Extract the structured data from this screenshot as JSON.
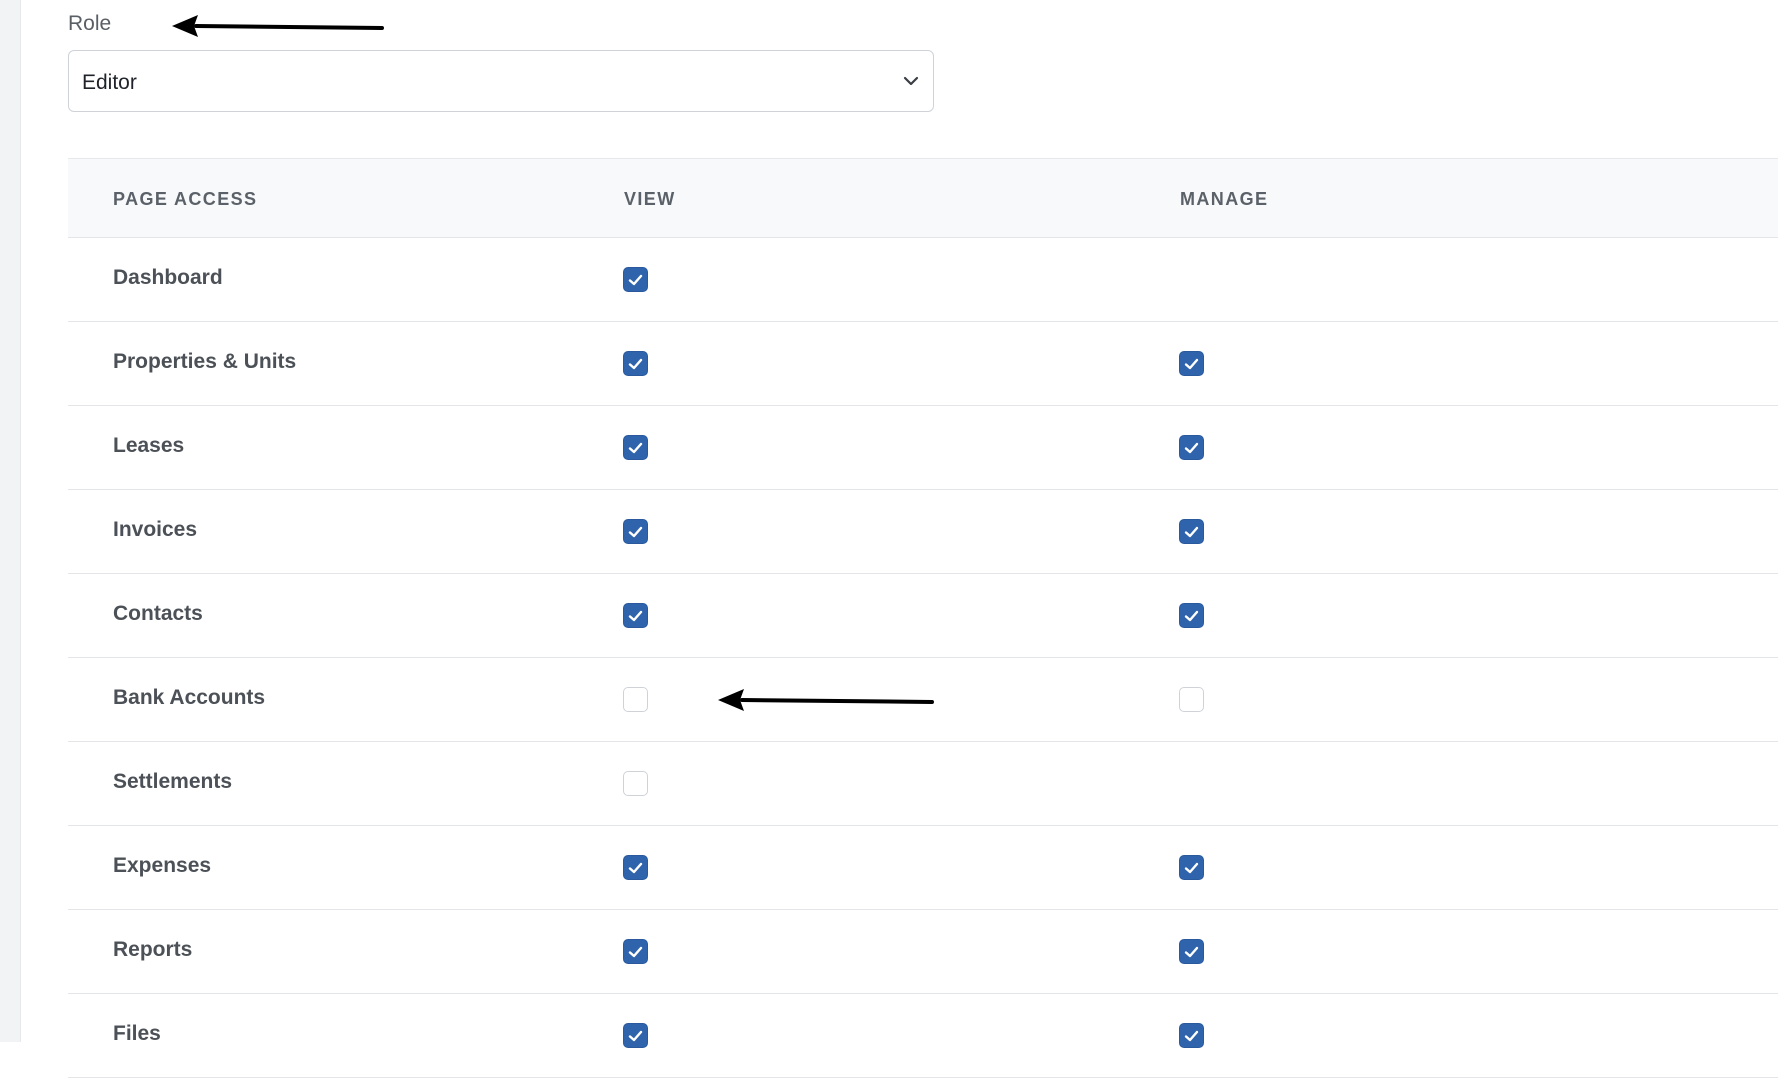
{
  "role": {
    "label": "Role",
    "value": "Editor"
  },
  "table": {
    "headers": {
      "page": "PAGE ACCESS",
      "view": "VIEW",
      "manage": "MANAGE"
    },
    "rows": [
      {
        "name": "Dashboard",
        "view": true,
        "manage": null
      },
      {
        "name": "Properties & Units",
        "view": true,
        "manage": true
      },
      {
        "name": "Leases",
        "view": true,
        "manage": true
      },
      {
        "name": "Invoices",
        "view": true,
        "manage": true
      },
      {
        "name": "Contacts",
        "view": true,
        "manage": true
      },
      {
        "name": "Bank Accounts",
        "view": false,
        "manage": false
      },
      {
        "name": "Settlements",
        "view": false,
        "manage": null
      },
      {
        "name": "Expenses",
        "view": true,
        "manage": true
      },
      {
        "name": "Reports",
        "view": true,
        "manage": true
      },
      {
        "name": "Files",
        "view": true,
        "manage": true
      }
    ]
  },
  "colors": {
    "checkbox_checked": "#2f64ad",
    "header_bg": "#f8f9fa",
    "annotation_arrow": "#000000"
  },
  "icons": {
    "select": "chevron-down-icon",
    "check": "checkmark-icon",
    "annotation": "arrow-left-icon"
  }
}
